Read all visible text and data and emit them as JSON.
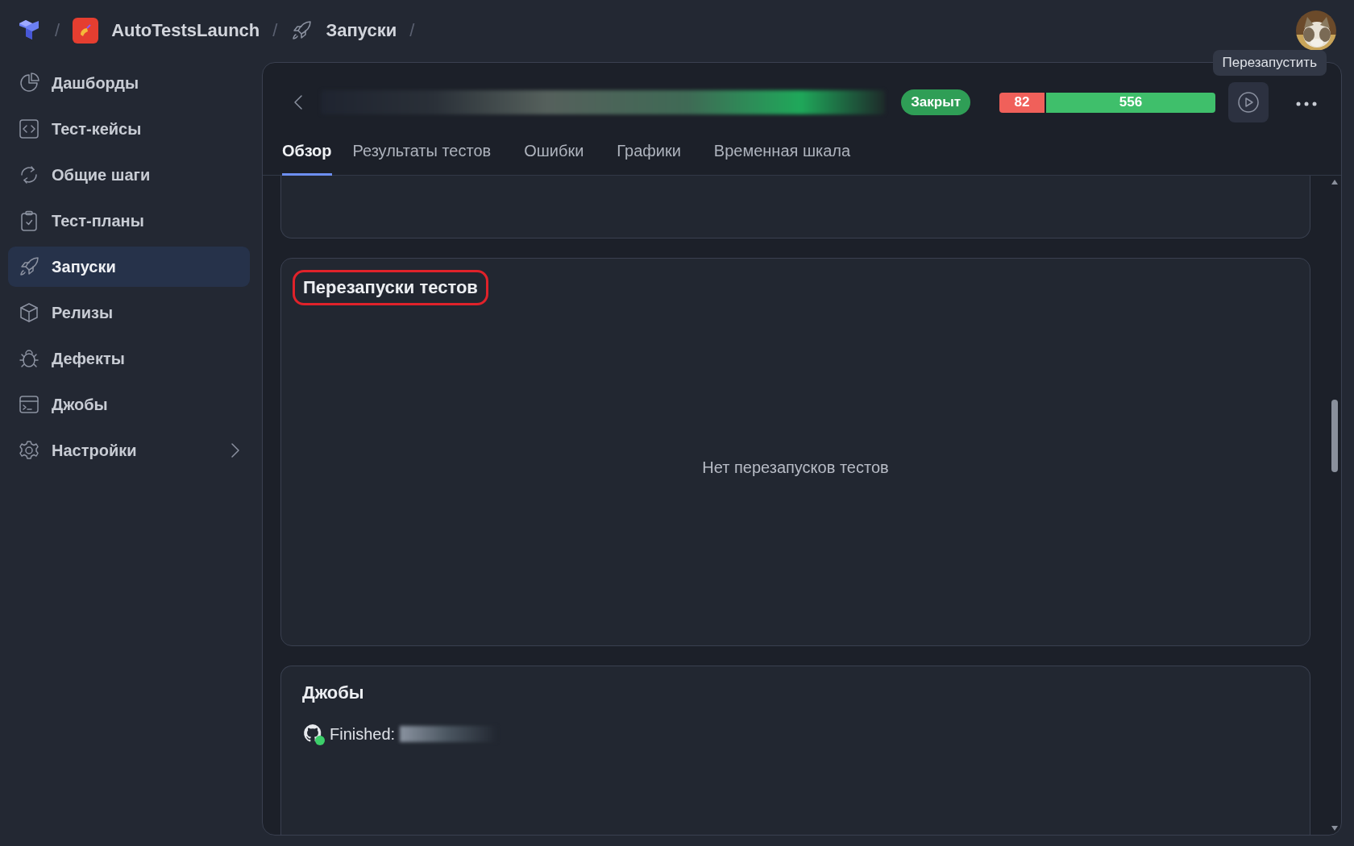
{
  "breadcrumbs": [
    {
      "kind": "logo",
      "separator": "/"
    },
    {
      "kind": "project",
      "label": "AutoTestsLaunch",
      "separator": "/"
    },
    {
      "kind": "section",
      "label": "Запуски",
      "separator": "/"
    }
  ],
  "sidebar": {
    "items": [
      {
        "label": "Дашборды",
        "selected": false
      },
      {
        "label": "Тест-кейсы",
        "selected": false
      },
      {
        "label": "Общие шаги",
        "selected": false
      },
      {
        "label": "Тест-планы",
        "selected": false
      },
      {
        "label": "Запуски",
        "selected": true
      },
      {
        "label": "Релизы",
        "selected": false
      },
      {
        "label": "Дефекты",
        "selected": false
      },
      {
        "label": "Джобы",
        "selected": false
      },
      {
        "label": "Настройки",
        "selected": false,
        "has_submenu": true
      }
    ]
  },
  "run": {
    "status": "Закрыт",
    "tooltip": "Перезапустить",
    "results": [
      {
        "count": "82",
        "color": "#f0605a",
        "level": 0.21
      },
      {
        "count": "556",
        "color": "#3fbf6b",
        "level": 0.79
      }
    ]
  },
  "tabs": [
    {
      "label": "Обзор",
      "selected": true
    },
    {
      "label": "Результаты тестов",
      "selected": false
    },
    {
      "label": "Ошибки",
      "selected": false
    },
    {
      "label": "Графики",
      "selected": false
    },
    {
      "label": "Временная шкала",
      "selected": false
    }
  ],
  "sections": [
    {
      "kind": "partial"
    },
    {
      "kind": "empty",
      "title": "Перезапуски тестов",
      "highlighted": true,
      "empty_text": "Нет перезапусков тестов"
    },
    {
      "kind": "jobs",
      "title": "Джобы",
      "jobs": [
        {
          "label": "Finished:",
          "color": "#3ccf6a"
        }
      ]
    }
  ]
}
